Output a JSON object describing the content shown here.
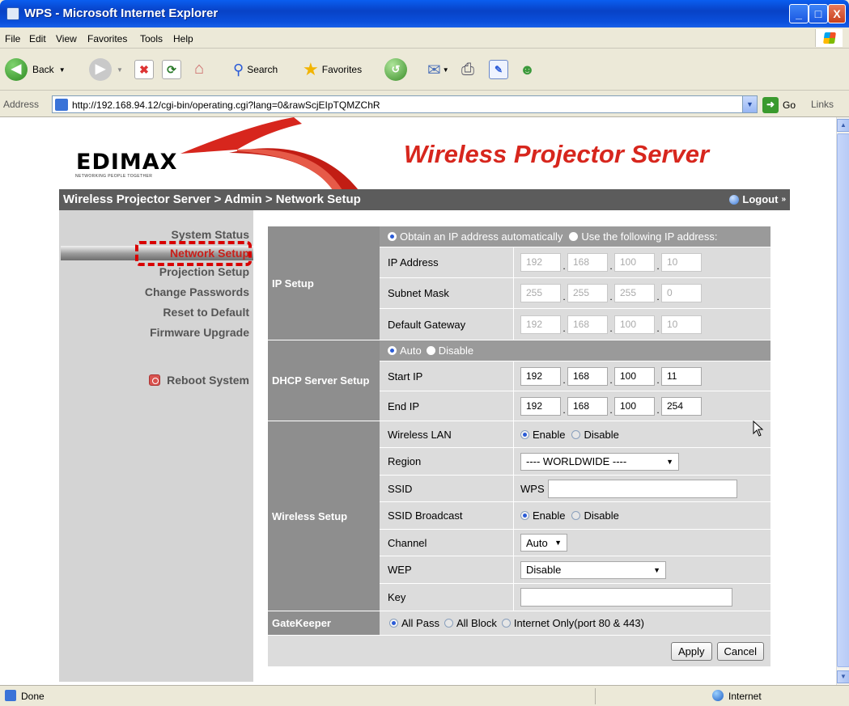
{
  "window": {
    "title": "WPS - Microsoft Internet Explorer",
    "controls": {
      "minimize": "_",
      "maximize": "□",
      "close": "X"
    }
  },
  "menubar": {
    "items": [
      "File",
      "Edit",
      "View",
      "Favorites",
      "Tools",
      "Help"
    ]
  },
  "toolbar": {
    "back": "Back",
    "search": "Search",
    "favorites": "Favorites"
  },
  "address": {
    "label": "Address",
    "url": "http://192.168.94.12/cgi-bin/operating.cgi?lang=0&rawScjEIpTQMZChR",
    "go": "Go",
    "links": "Links"
  },
  "header": {
    "logo": "EDIMAX",
    "logo_tagline": "NETWORKING PEOPLE TOGETHER",
    "headline": "Wireless Projector Server"
  },
  "breadcrumb": {
    "text": "Wireless Projector Server > Admin > Network Setup",
    "logout": "Logout"
  },
  "sidebar": {
    "items": [
      "System Status",
      "Network Setup",
      "Projection Setup",
      "Change Passwords",
      "Reset to Default",
      "Firmware Upgrade"
    ],
    "active": "Network Setup",
    "reboot": "Reboot System"
  },
  "ip_setup": {
    "section": "IP Setup",
    "option_auto": "Obtain an IP address automatically",
    "option_static": "Use the following IP address:",
    "selected": "auto",
    "ip_label": "IP Address",
    "ip": [
      "192",
      "168",
      "100",
      "10"
    ],
    "mask_label": "Subnet Mask",
    "mask": [
      "255",
      "255",
      "255",
      "0"
    ],
    "gw_label": "Default Gateway",
    "gw": [
      "192",
      "168",
      "100",
      "10"
    ]
  },
  "dhcp": {
    "section": "DHCP Server Setup",
    "option_auto": "Auto",
    "option_disable": "Disable",
    "selected": "auto",
    "start_label": "Start IP",
    "start": [
      "192",
      "168",
      "100",
      "11"
    ],
    "end_label": "End IP",
    "end": [
      "192",
      "168",
      "100",
      "254"
    ]
  },
  "wireless": {
    "section": "Wireless Setup",
    "lan_label": "Wireless LAN",
    "lan_enable": "Enable",
    "lan_disable": "Disable",
    "lan_selected": "enable",
    "region_label": "Region",
    "region": "---- WORLDWIDE ----",
    "ssid_label": "SSID",
    "ssid_prefix": "WPS",
    "ssid_value": "",
    "broadcast_label": "SSID Broadcast",
    "broadcast_enable": "Enable",
    "broadcast_disable": "Disable",
    "broadcast_selected": "enable",
    "channel_label": "Channel",
    "channel": "Auto",
    "wep_label": "WEP",
    "wep": "Disable",
    "key_label": "Key",
    "key": ""
  },
  "gatekeeper": {
    "section": "GateKeeper",
    "options": [
      "All Pass",
      "All Block",
      "Internet Only(port 80 & 443)"
    ],
    "selected": "All Pass"
  },
  "actions": {
    "apply": "Apply",
    "cancel": "Cancel"
  },
  "statusbar": {
    "text": "Done",
    "zone": "Internet"
  },
  "colors": {
    "titlebar": "#0842c6",
    "headline": "#d7261d",
    "section_bg": "#8e8e8e",
    "row_bg": "#dcdcdc",
    "highlight": "#d80000"
  }
}
